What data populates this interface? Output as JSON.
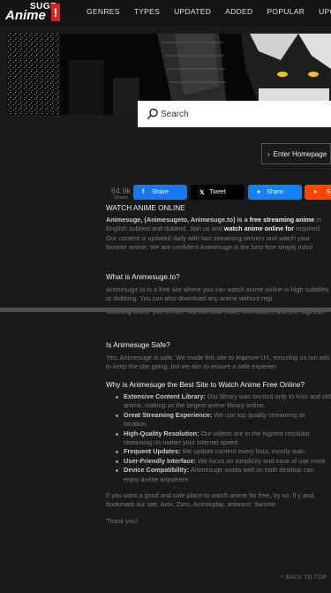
{
  "logo": {
    "top": "SUGE",
    "main": "Anime",
    "bang": "!"
  },
  "nav": [
    "GENRES",
    "TYPES",
    "UPDATED",
    "ADDED",
    "POPULAR",
    "UPCOMING"
  ],
  "search": {
    "placeholder": "Search"
  },
  "enter_homepage": "Enter Homepage",
  "share": {
    "count": "64.9k",
    "count_label": "Shares",
    "facebook": "Share",
    "twitter": "Tweet",
    "messenger": "Share",
    "reddit": "S"
  },
  "content": {
    "heading1": "WATCH ANIME ONLINE",
    "intro": {
      "t1": "Animesuge, (Animesugeto, Animesuge.to) is a ",
      "b1": "free streaming anime",
      "t2": " in English subbed and dubbed. Join us and ",
      "b2": "watch anime online for",
      "t3": " required. Our content is updated daily with fast streaming servers and watch your favorite anime. We are confident Animesuge is the best free simply miss!"
    },
    "heading2": "What is Animesuge.to?",
    "what_is": "Animesuge.to is a free site where you can watch anime online in high subtitles or dubbing. You can also download any anime without regi",
    "what_is_cont": "watching where you left off. You can also make new folders and use together.",
    "heading3": "Is Animesuge Safe?",
    "safe": "Yes, Animesuge is safe. We made this site to improve UX, ensuring us run ads to keep the site going, but we aim to ensure a safe experien",
    "heading4": "Why is Animesuge the Best Site to Watch Anime Free Online?",
    "features": [
      {
        "title": "Extensive Content Library:",
        "text": " Our library was second only to Kiss and old anime, making us the largest anime library online."
      },
      {
        "title": "Great Streaming Experience:",
        "text": " We use top quality streaming se location."
      },
      {
        "title": "High-Quality Resolution:",
        "text": " Our videos are in the highest resolutio streaming no matter your internet speed."
      },
      {
        "title": "Frequent Updates:",
        "text": " We update content every hour, mostly auto"
      },
      {
        "title": "User-Friendly Interface:",
        "text": " We focus on simplicity and ease of use more."
      },
      {
        "title": "Device Compatibility:",
        "text": " Animesuge works well on both desktop can enjoy anime anywhere."
      }
    ],
    "outro": "If you want a good and safe place to watch anime for free, try us. If y and bookmark our site. Anix, Zoro, Animixplay, aniwave, 9anime.",
    "thanks": "Thank you!"
  },
  "back_to_top": "BACK TO TOP",
  "colors": {
    "accent": "#d8261c",
    "background": "#1a1a1a",
    "facebook": "#1877f2",
    "messenger": "#1183f2",
    "reddit": "#ff4500"
  },
  "icons": {
    "search": "search-icon",
    "enter": "chevron-right-icon",
    "back_to_top": "chevron-up-icon"
  }
}
